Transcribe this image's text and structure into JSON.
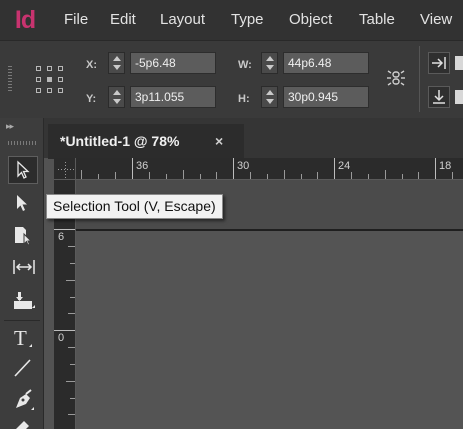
{
  "app": {
    "logo": "Id",
    "brand_color": "#c8336f"
  },
  "menubar": {
    "items": [
      "File",
      "Edit",
      "Layout",
      "Type",
      "Object",
      "Table",
      "View"
    ]
  },
  "control_panel": {
    "x": {
      "label": "X:",
      "value": "-5p6.48"
    },
    "y": {
      "label": "Y:",
      "value": "3p11.055"
    },
    "w": {
      "label": "W:",
      "value": "44p6.48"
    },
    "h": {
      "label": "H:",
      "value": "30p0.945"
    },
    "icons": [
      "reference-point-grid-icon",
      "constrain-proportions-link-icon",
      "align-right-button-icon",
      "align-bottom-button-icon"
    ]
  },
  "document_tab": {
    "title": "*Untitled-1 @ 78%",
    "close": "×"
  },
  "ruler": {
    "horizontal_labels": [
      "36",
      "30",
      "24",
      "18"
    ],
    "vertical_labels": [
      "6",
      "0"
    ]
  },
  "tools": [
    "selection-tool",
    "direct-selection-tool",
    "page-tool",
    "gap-tool",
    "content-collector-tool",
    "type-tool",
    "line-tool",
    "pen-tool",
    "pencil-tool"
  ],
  "tooltip": {
    "text": "Selection Tool (V, Escape)"
  }
}
